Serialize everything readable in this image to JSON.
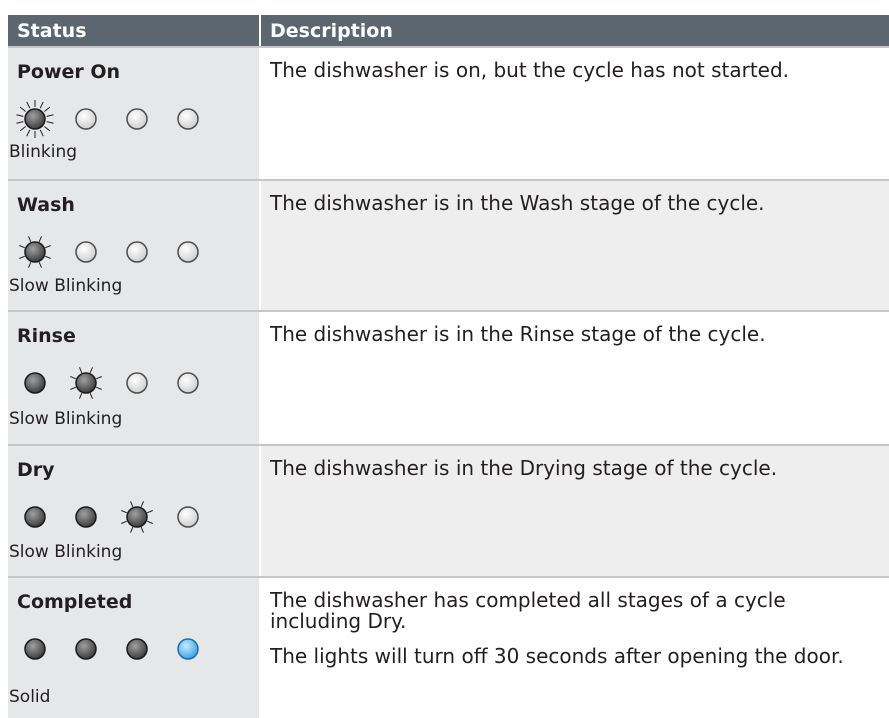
{
  "header": {
    "status_label": "Status",
    "description_label": "Description"
  },
  "rows": [
    {
      "stage": "Power On",
      "mode": "Blinking",
      "lights": [
        "blink-fast",
        "off",
        "off",
        "off"
      ],
      "description": [
        "The dishwasher is on, but the cycle has not started."
      ]
    },
    {
      "stage": "Wash",
      "mode": "Slow Blinking",
      "lights": [
        "blink-slow",
        "off",
        "off",
        "off"
      ],
      "description": [
        "The dishwasher is in the Wash stage of the cycle."
      ]
    },
    {
      "stage": "Rinse",
      "mode": "Slow Blinking",
      "lights": [
        "on",
        "blink-slow",
        "off",
        "off"
      ],
      "description": [
        "The dishwasher is in the Rinse stage of the cycle."
      ]
    },
    {
      "stage": "Dry",
      "mode": "Slow Blinking",
      "lights": [
        "on",
        "on",
        "blink-slow",
        "off"
      ],
      "description": [
        "The dishwasher is in the Drying stage of the cycle."
      ]
    },
    {
      "stage": "Completed",
      "mode": "Solid",
      "lights": [
        "on",
        "on",
        "on",
        "blue"
      ],
      "description": [
        "The dishwasher has completed all stages of a cycle including Dry.",
        "The lights will turn off 30 seconds after opening the door."
      ]
    }
  ],
  "colors": {
    "header_bg": "#5c6670",
    "status_bg": "#e6e7e8",
    "alt_row_bg": "#eeeeef",
    "light_on": "#3d3d3d",
    "light_off": "#f2f2f2",
    "light_blue": "#3aa6e6"
  }
}
